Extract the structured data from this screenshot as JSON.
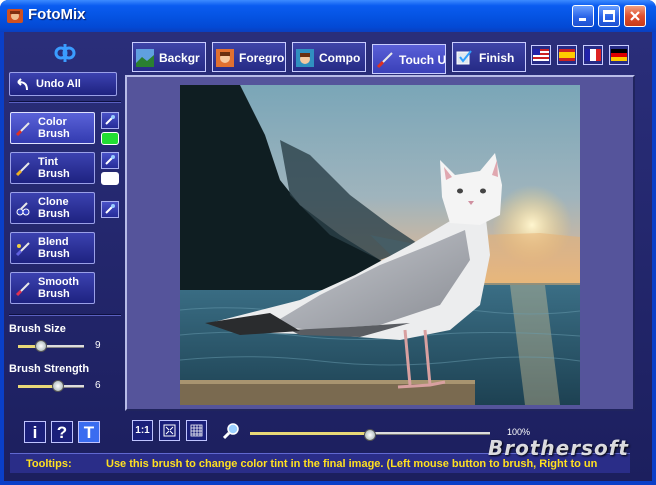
{
  "window": {
    "title": "FotoMix"
  },
  "sidebar": {
    "undo_all": "Undo All",
    "brushes": [
      {
        "line1": "Color",
        "line2": "Brush"
      },
      {
        "line1": "Tint",
        "line2": "Brush"
      },
      {
        "line1": "Clone",
        "line2": "Brush"
      },
      {
        "line1": "Blend",
        "line2": "Brush"
      },
      {
        "line1": "Smooth",
        "line2": "Brush"
      }
    ],
    "swatch_color": "#22dd33",
    "tint_swatch_color": "#ffffff",
    "brush_size": {
      "label": "Brush Size",
      "value": "9",
      "level": 0.35
    },
    "brush_strength": {
      "label": "Brush Strength",
      "value": "6",
      "level": 0.6
    },
    "bottom_buttons": [
      "i",
      "?",
      "T"
    ]
  },
  "tabs": [
    {
      "label": "Backgr"
    },
    {
      "label": "Foregro"
    },
    {
      "label": "Compo"
    },
    {
      "label": "Touch U"
    },
    {
      "label": "Finish"
    }
  ],
  "zoom": {
    "value": "100%",
    "level": 0.5,
    "btn_1to1": "1:1"
  },
  "tooltip": {
    "label": "Tooltips:",
    "text": "Use this brush to change color tint in the final image. (Left mouse button to brush, Right to un"
  },
  "watermark": "Brothersoft",
  "colors": {
    "accent": "#0a3fc8",
    "panel": "#2a2e7a",
    "tooltip_text": "#ffe020"
  }
}
